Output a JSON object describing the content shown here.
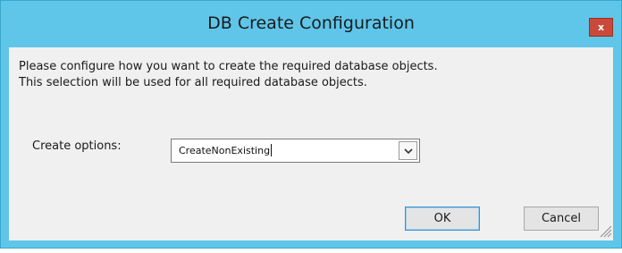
{
  "window": {
    "title": "DB Create Configuration",
    "close_label": "x"
  },
  "description": {
    "line1": "Please configure how you want to create the required database objects.",
    "line2": "This selection will be used for all required database objects."
  },
  "options": {
    "label": "Create options:",
    "selected_value": "CreateNonExisting"
  },
  "buttons": {
    "ok_label": "OK",
    "cancel_label": "Cancel"
  },
  "colors": {
    "titlebar": "#5fc6ea",
    "close": "#c94a3a",
    "client": "#f0f0f0",
    "default_button_border": "#3c8fcf"
  },
  "icons": {
    "close": "close-icon",
    "dropdown": "chevron-down-icon",
    "resize": "resize-grip-icon"
  }
}
